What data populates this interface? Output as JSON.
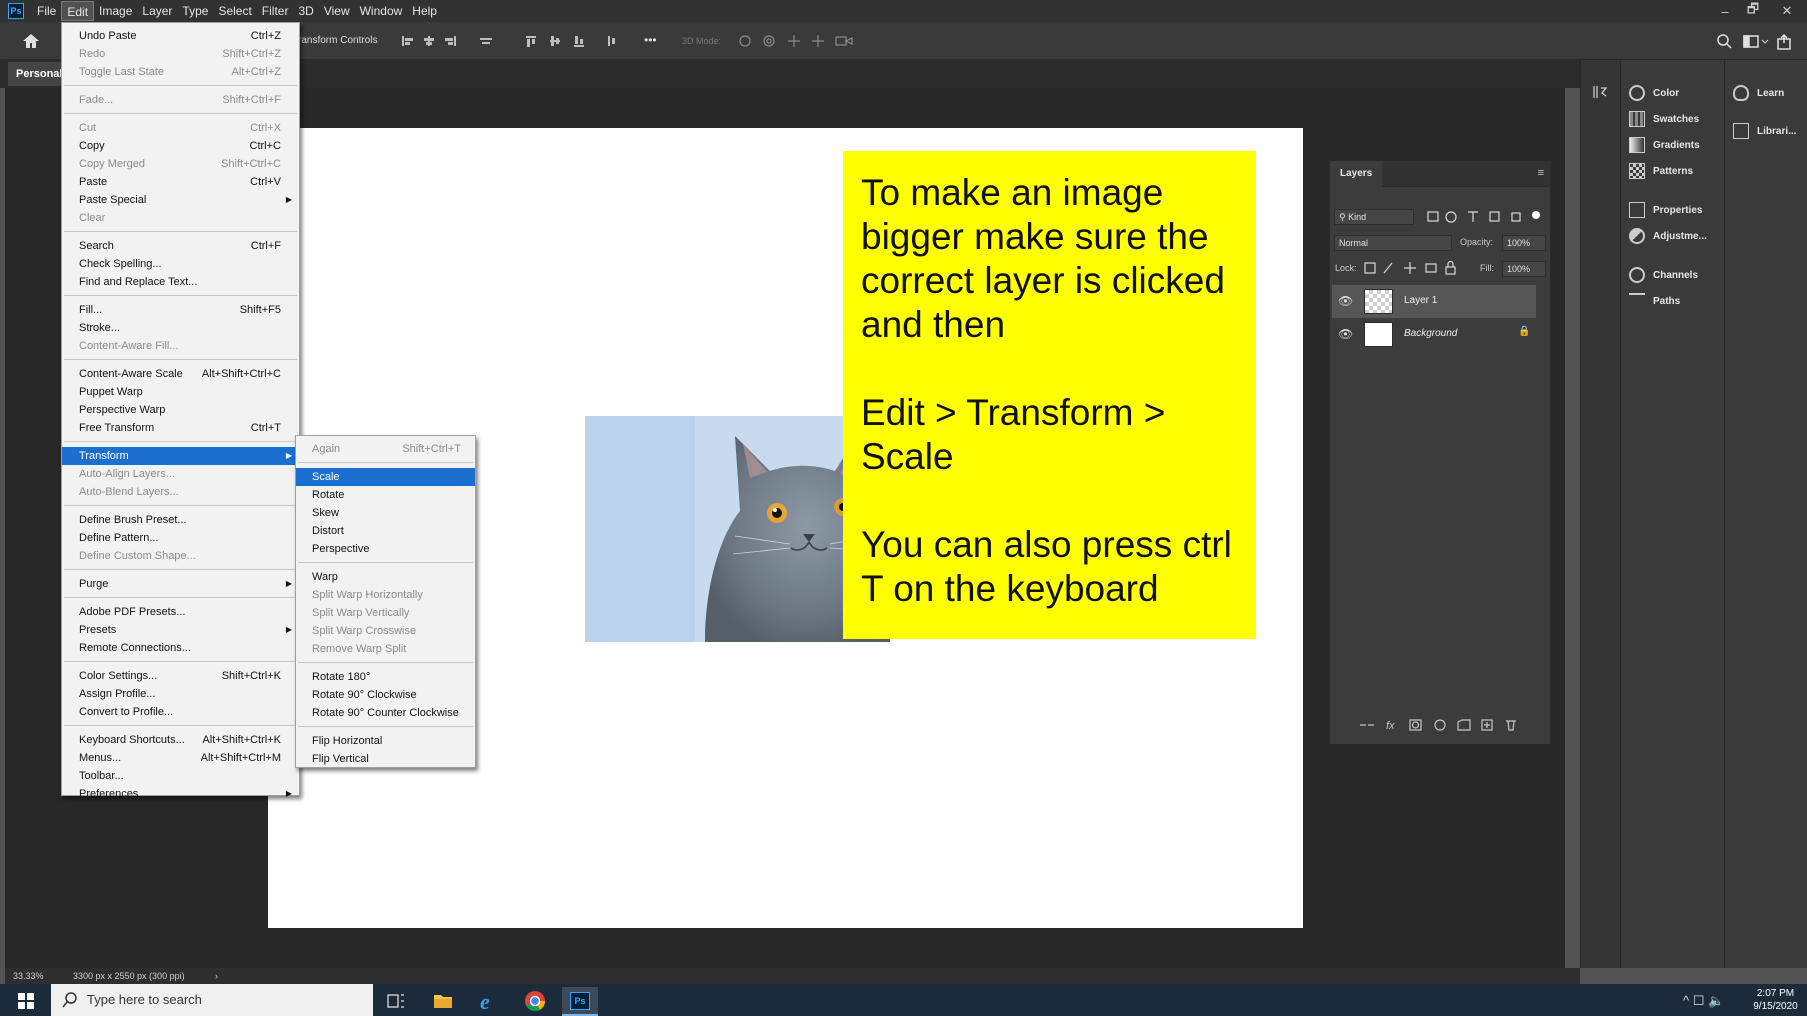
{
  "app": {
    "logo_text": "Ps",
    "menus": [
      "File",
      "Edit",
      "Image",
      "Layer",
      "Type",
      "Select",
      "Filter",
      "3D",
      "View",
      "Window",
      "Help"
    ],
    "active_menu": "Edit",
    "window_controls": [
      "–",
      "🗗",
      "✕"
    ]
  },
  "options_bar": {
    "transform_controls_label": "ransform Controls",
    "mode_3d_label": "3D Mode:",
    "more_label": "•••"
  },
  "document_tab": {
    "label": "Personal"
  },
  "edit_menu": {
    "items": [
      {
        "label": "Undo Paste",
        "shortcut": "Ctrl+Z",
        "disabled": false
      },
      {
        "label": "Redo",
        "shortcut": "Shift+Ctrl+Z",
        "disabled": true
      },
      {
        "label": "Toggle Last State",
        "shortcut": "Alt+Ctrl+Z",
        "disabled": true
      },
      {
        "label": "Fade...",
        "shortcut": "Shift+Ctrl+F",
        "disabled": true
      },
      {
        "label": "Cut",
        "shortcut": "Ctrl+X",
        "disabled": true
      },
      {
        "label": "Copy",
        "shortcut": "Ctrl+C",
        "disabled": false
      },
      {
        "label": "Copy Merged",
        "shortcut": "Shift+Ctrl+C",
        "disabled": true
      },
      {
        "label": "Paste",
        "shortcut": "Ctrl+V",
        "disabled": false
      },
      {
        "label": "Paste Special",
        "shortcut": "",
        "disabled": false,
        "submenu": true
      },
      {
        "label": "Clear",
        "shortcut": "",
        "disabled": true
      },
      {
        "label": "Search",
        "shortcut": "Ctrl+F",
        "disabled": false
      },
      {
        "label": "Check Spelling...",
        "shortcut": "",
        "disabled": false
      },
      {
        "label": "Find and Replace Text...",
        "shortcut": "",
        "disabled": false
      },
      {
        "label": "Fill...",
        "shortcut": "Shift+F5",
        "disabled": false
      },
      {
        "label": "Stroke...",
        "shortcut": "",
        "disabled": false
      },
      {
        "label": "Content-Aware Fill...",
        "shortcut": "",
        "disabled": true
      },
      {
        "label": "Content-Aware Scale",
        "shortcut": "Alt+Shift+Ctrl+C",
        "disabled": false
      },
      {
        "label": "Puppet Warp",
        "shortcut": "",
        "disabled": false
      },
      {
        "label": "Perspective Warp",
        "shortcut": "",
        "disabled": false
      },
      {
        "label": "Free Transform",
        "shortcut": "Ctrl+T",
        "disabled": false
      },
      {
        "label": "Transform",
        "shortcut": "",
        "disabled": false,
        "submenu": true,
        "highlighted": true
      },
      {
        "label": "Auto-Align Layers...",
        "shortcut": "",
        "disabled": true
      },
      {
        "label": "Auto-Blend Layers...",
        "shortcut": "",
        "disabled": true
      },
      {
        "label": "Define Brush Preset...",
        "shortcut": "",
        "disabled": false
      },
      {
        "label": "Define Pattern...",
        "shortcut": "",
        "disabled": false
      },
      {
        "label": "Define Custom Shape...",
        "shortcut": "",
        "disabled": true
      },
      {
        "label": "Purge",
        "shortcut": "",
        "disabled": false,
        "submenu": true
      },
      {
        "label": "Adobe PDF Presets...",
        "shortcut": "",
        "disabled": false
      },
      {
        "label": "Presets",
        "shortcut": "",
        "disabled": false,
        "submenu": true
      },
      {
        "label": "Remote Connections...",
        "shortcut": "",
        "disabled": false
      },
      {
        "label": "Color Settings...",
        "shortcut": "Shift+Ctrl+K",
        "disabled": false
      },
      {
        "label": "Assign Profile...",
        "shortcut": "",
        "disabled": false
      },
      {
        "label": "Convert to Profile...",
        "shortcut": "",
        "disabled": false
      },
      {
        "label": "Keyboard Shortcuts...",
        "shortcut": "Alt+Shift+Ctrl+K",
        "disabled": false
      },
      {
        "label": "Menus...",
        "shortcut": "Alt+Shift+Ctrl+M",
        "disabled": false
      },
      {
        "label": "Toolbar...",
        "shortcut": "",
        "disabled": false
      },
      {
        "label": "Preferences",
        "shortcut": "",
        "disabled": false,
        "submenu": true
      }
    ]
  },
  "transform_menu": {
    "items": [
      {
        "label": "Again",
        "shortcut": "Shift+Ctrl+T",
        "disabled": true
      },
      {
        "label": "Scale",
        "shortcut": "",
        "disabled": false,
        "highlighted": true
      },
      {
        "label": "Rotate",
        "shortcut": "",
        "disabled": false
      },
      {
        "label": "Skew",
        "shortcut": "",
        "disabled": false
      },
      {
        "label": "Distort",
        "shortcut": "",
        "disabled": false
      },
      {
        "label": "Perspective",
        "shortcut": "",
        "disabled": false
      },
      {
        "label": "Warp",
        "shortcut": "",
        "disabled": false
      },
      {
        "label": "Split Warp Horizontally",
        "shortcut": "",
        "disabled": true
      },
      {
        "label": "Split Warp Vertically",
        "shortcut": "",
        "disabled": true
      },
      {
        "label": "Split Warp Crosswise",
        "shortcut": "",
        "disabled": true
      },
      {
        "label": "Remove Warp Split",
        "shortcut": "",
        "disabled": true
      },
      {
        "label": "Rotate 180°",
        "shortcut": "",
        "disabled": false
      },
      {
        "label": "Rotate 90° Clockwise",
        "shortcut": "",
        "disabled": false
      },
      {
        "label": "Rotate 90° Counter Clockwise",
        "shortcut": "",
        "disabled": false
      },
      {
        "label": "Flip Horizontal",
        "shortcut": "",
        "disabled": false
      },
      {
        "label": "Flip Vertical",
        "shortcut": "",
        "disabled": false
      }
    ]
  },
  "note": {
    "paragraphs": [
      "To make an image bigger make sure the correct layer is clicked and then",
      "Edit > Transform > Scale",
      "You can also press ctrl T on the keyboard"
    ],
    "background": "#ffff00"
  },
  "layers_panel": {
    "tab": "Layers",
    "filter_kind": "Kind",
    "blend_mode": "Normal",
    "opacity_label": "Opacity:",
    "opacity_value": "100%",
    "lock_label": "Lock:",
    "fill_label": "Fill:",
    "fill_value": "100%",
    "layers": [
      {
        "name": "Layer 1",
        "selected": true
      },
      {
        "name": "Background",
        "selected": false,
        "italic": true
      }
    ]
  },
  "dock": {
    "group1": [
      "Color",
      "Swatches",
      "Gradients",
      "Patterns"
    ],
    "group2": [
      "Properties",
      "Adjustme..."
    ],
    "group3": [
      "Channels",
      "Paths"
    ],
    "learn": [
      "Learn",
      "Librari..."
    ]
  },
  "status": {
    "zoom": "33.33%",
    "doc_info": "3300 px x 2550 px (300 ppi)"
  },
  "taskbar": {
    "search_placeholder": "Type here to search",
    "time": "2:07 PM",
    "date": "9/15/2020"
  }
}
